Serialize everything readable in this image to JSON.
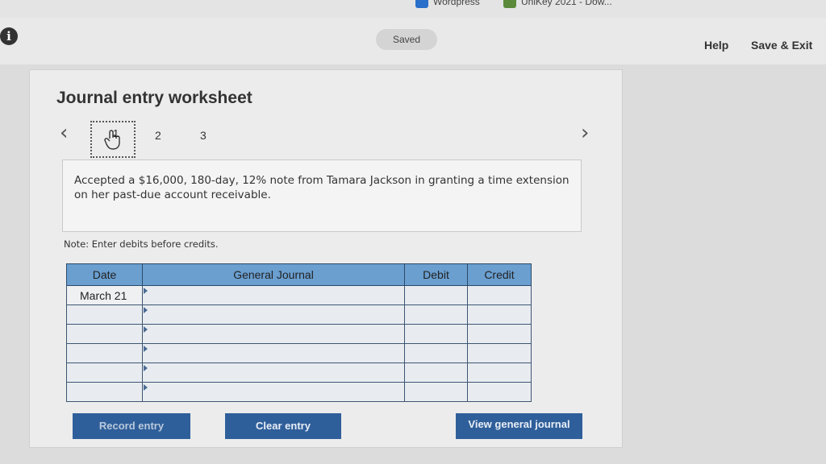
{
  "browser": {
    "bookmarks": [
      {
        "label": "Wordpress",
        "icon": "wordpress-icon",
        "color": "#2a6fc9"
      },
      {
        "label": "UniKey 2021 - Dow...",
        "icon": "unikey-icon",
        "color": "#5a8a3a"
      }
    ]
  },
  "header": {
    "saved_label": "Saved",
    "help_label": "Help",
    "save_exit_label": "Save & Exit",
    "info_icon_glyph": "i"
  },
  "worksheet": {
    "title": "Journal entry worksheet",
    "tabs": [
      {
        "label": "1"
      },
      {
        "label": "2"
      },
      {
        "label": "3"
      }
    ],
    "description": "Accepted a $16,000, 180-day, 12% note from Tamara Jackson in granting a time extension on her past-due account receivable.",
    "note": "Note: Enter debits before credits.",
    "table": {
      "headers": [
        "Date",
        "General Journal",
        "Debit",
        "Credit"
      ],
      "rows": [
        {
          "date": "March 21",
          "account": "",
          "debit": "",
          "credit": ""
        },
        {
          "date": "",
          "account": "",
          "debit": "",
          "credit": ""
        },
        {
          "date": "",
          "account": "",
          "debit": "",
          "credit": ""
        },
        {
          "date": "",
          "account": "",
          "debit": "",
          "credit": ""
        },
        {
          "date": "",
          "account": "",
          "debit": "",
          "credit": ""
        },
        {
          "date": "",
          "account": "",
          "debit": "",
          "credit": ""
        }
      ]
    },
    "buttons": {
      "record": "Record entry",
      "clear": "Clear entry",
      "view": "View general journal"
    }
  },
  "colors": {
    "header_blue": "#6a9fd0",
    "button_blue": "#2f5f9a"
  }
}
